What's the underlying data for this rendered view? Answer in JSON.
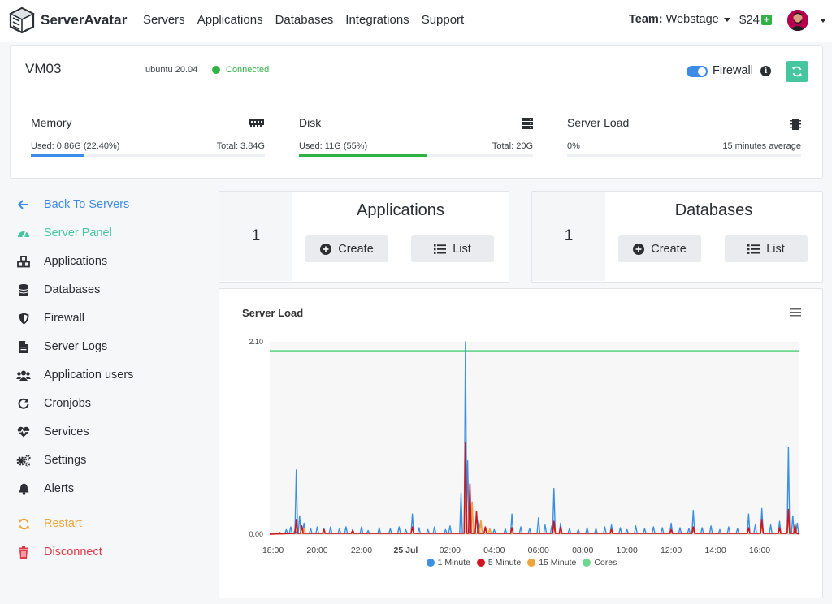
{
  "brand": {
    "name": "ServerAvatar"
  },
  "nav": [
    {
      "label": "Servers"
    },
    {
      "label": "Applications"
    },
    {
      "label": "Databases"
    },
    {
      "label": "Integrations"
    },
    {
      "label": "Support"
    }
  ],
  "team": {
    "prefix": "Team:",
    "name": "Webstage"
  },
  "credit": {
    "amount": "$24",
    "plus": "+"
  },
  "server": {
    "name": "VM03",
    "os": "ubuntu 20.04",
    "status": "Connected",
    "firewall_label": "Firewall",
    "firewall_on": true,
    "info": "i"
  },
  "metrics": {
    "memory": {
      "title": "Memory",
      "used": "Used: 0.86G (22.40%)",
      "total": "Total: 3.84G",
      "percent": 22.4,
      "color": "#3d8be8"
    },
    "disk": {
      "title": "Disk",
      "used": "Used: 11G (55%)",
      "total": "Total: 20G",
      "percent": 55,
      "color": "#2fb344"
    },
    "load": {
      "title": "Server Load",
      "used": "0%",
      "total": "15 minutes average",
      "percent": 0,
      "color": "#c9cdd2"
    }
  },
  "sidebar": {
    "items": [
      {
        "label": "Back To Servers",
        "icon": "arrow-left-icon",
        "color": "#3d8be8"
      },
      {
        "label": "Server Panel",
        "icon": "speedometer-icon",
        "color": "#45c69e"
      },
      {
        "label": "Applications",
        "icon": "cubes-icon",
        "color": "#2b2f33"
      },
      {
        "label": "Databases",
        "icon": "database-icon",
        "color": "#2b2f33"
      },
      {
        "label": "Firewall",
        "icon": "shield-icon",
        "color": "#2b2f33"
      },
      {
        "label": "Server Logs",
        "icon": "file-icon",
        "color": "#2b2f33"
      },
      {
        "label": "Application users",
        "icon": "users-icon",
        "color": "#2b2f33"
      },
      {
        "label": "Cronjobs",
        "icon": "redo-icon",
        "color": "#2b2f33"
      },
      {
        "label": "Services",
        "icon": "heartbeat-icon",
        "color": "#2b2f33"
      },
      {
        "label": "Settings",
        "icon": "cogs-icon",
        "color": "#2b2f33"
      },
      {
        "label": "Alerts",
        "icon": "bell-icon",
        "color": "#2b2f33"
      },
      {
        "label": "Restart",
        "icon": "sync-icon",
        "color": "#f0a33a"
      },
      {
        "label": "Disconnect",
        "icon": "trash-icon",
        "color": "#e03a4a"
      }
    ]
  },
  "applications_panel": {
    "count": "1",
    "title": "Applications",
    "create": "Create",
    "list": "List"
  },
  "databases_panel": {
    "count": "1",
    "title": "Databases",
    "create": "Create",
    "list": "List"
  },
  "chart_data": {
    "type": "line",
    "title": "Server Load",
    "x_ticks": [
      "18:00",
      "20:00",
      "22:00",
      "25 Jul",
      "02:00",
      "04:00",
      "06:00",
      "08:00",
      "10:00",
      "12:00",
      "14:00",
      "16:00"
    ],
    "y_ticks": [
      "0.00",
      "2.10"
    ],
    "ylim": [
      0,
      2.1
    ],
    "x_range_hours": [
      17.85,
      41.8
    ],
    "grid": false,
    "legend_position": "bottom",
    "series": [
      {
        "name": "1 Minute",
        "color": "#3d8fe0",
        "peaks": [
          [
            18.3,
            0.02
          ],
          [
            18.6,
            0.05
          ],
          [
            18.8,
            0.08
          ],
          [
            19.0,
            0.06
          ],
          [
            19.05,
            0.7
          ],
          [
            19.2,
            0.2
          ],
          [
            19.4,
            0.12
          ],
          [
            19.7,
            0.06
          ],
          [
            20.0,
            0.08
          ],
          [
            20.3,
            0.06
          ],
          [
            20.6,
            0.08
          ],
          [
            21.0,
            0.06
          ],
          [
            21.3,
            0.08
          ],
          [
            21.6,
            0.05
          ],
          [
            22.0,
            0.08
          ],
          [
            22.3,
            0.04
          ],
          [
            22.8,
            0.07
          ],
          [
            23.3,
            0.06
          ],
          [
            23.7,
            0.08
          ],
          [
            24.0,
            0.05
          ],
          [
            24.3,
            0.22
          ],
          [
            24.6,
            0.07
          ],
          [
            25.0,
            0.05
          ],
          [
            25.3,
            0.08
          ],
          [
            25.8,
            0.05
          ],
          [
            26.0,
            0.09
          ],
          [
            26.5,
            0.45
          ],
          [
            26.7,
            2.1
          ],
          [
            26.8,
            0.8
          ],
          [
            27.0,
            0.35
          ],
          [
            27.3,
            0.15
          ],
          [
            27.6,
            0.07
          ],
          [
            28.0,
            0.05
          ],
          [
            28.5,
            0.06
          ],
          [
            28.8,
            0.22
          ],
          [
            29.2,
            0.08
          ],
          [
            29.6,
            0.06
          ],
          [
            30.0,
            0.18
          ],
          [
            30.3,
            0.1
          ],
          [
            30.6,
            0.09
          ],
          [
            30.7,
            0.5
          ],
          [
            31.0,
            0.12
          ],
          [
            31.4,
            0.06
          ],
          [
            31.8,
            0.05
          ],
          [
            32.2,
            0.07
          ],
          [
            32.6,
            0.06
          ],
          [
            33.0,
            0.08
          ],
          [
            33.3,
            0.1
          ],
          [
            33.7,
            0.07
          ],
          [
            34.0,
            0.05
          ],
          [
            34.4,
            0.09
          ],
          [
            34.8,
            0.06
          ],
          [
            35.2,
            0.08
          ],
          [
            35.6,
            0.07
          ],
          [
            36.0,
            0.12
          ],
          [
            36.4,
            0.07
          ],
          [
            36.8,
            0.06
          ],
          [
            37.0,
            0.26
          ],
          [
            37.4,
            0.07
          ],
          [
            37.8,
            0.09
          ],
          [
            38.2,
            0.05
          ],
          [
            38.6,
            0.08
          ],
          [
            39.0,
            0.06
          ],
          [
            39.5,
            0.22
          ],
          [
            39.8,
            0.1
          ],
          [
            40.1,
            0.28
          ],
          [
            40.5,
            0.1
          ],
          [
            40.9,
            0.14
          ],
          [
            41.3,
            0.95
          ],
          [
            41.5,
            0.2
          ],
          [
            41.7,
            0.12
          ]
        ]
      },
      {
        "name": "5 Minute",
        "color": "#d0151e",
        "peaks": [
          [
            19.05,
            0.16
          ],
          [
            19.3,
            0.09
          ],
          [
            20.3,
            0.05
          ],
          [
            21.6,
            0.04
          ],
          [
            24.3,
            0.08
          ],
          [
            26.7,
            1.0
          ],
          [
            26.9,
            0.55
          ],
          [
            27.2,
            0.25
          ],
          [
            27.6,
            0.08
          ],
          [
            28.8,
            0.07
          ],
          [
            30.7,
            0.14
          ],
          [
            31.0,
            0.08
          ],
          [
            33.3,
            0.05
          ],
          [
            36.0,
            0.05
          ],
          [
            37.0,
            0.08
          ],
          [
            39.5,
            0.07
          ],
          [
            40.1,
            0.16
          ],
          [
            40.9,
            0.07
          ],
          [
            41.3,
            0.27
          ],
          [
            41.6,
            0.1
          ]
        ]
      },
      {
        "name": "15 Minute",
        "color": "#f0a33a",
        "peaks": [
          [
            19.05,
            0.09
          ],
          [
            19.4,
            0.06
          ],
          [
            26.7,
            0.55
          ],
          [
            27.0,
            0.35
          ],
          [
            27.4,
            0.15
          ],
          [
            27.8,
            0.06
          ],
          [
            30.7,
            0.09
          ],
          [
            37.0,
            0.05
          ],
          [
            40.1,
            0.1
          ],
          [
            41.3,
            0.18
          ],
          [
            41.6,
            0.1
          ]
        ]
      },
      {
        "name": "Cores",
        "color": "#6fd88f",
        "constant": 2.0
      }
    ]
  }
}
